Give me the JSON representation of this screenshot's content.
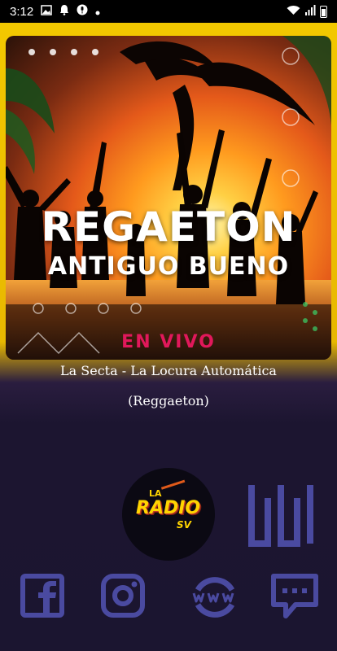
{
  "status_bar": {
    "time": "3:12",
    "signal_text": "all"
  },
  "cover": {
    "title_line1": "REGAETON",
    "title_line2": "ANTIGUO BUENO",
    "live_label": "EN VIVO",
    "live_color": "#e1185b"
  },
  "now_playing": {
    "title": "La Secta - La Locura Automática",
    "genre": "(Reggaeton)"
  },
  "logo": {
    "la": "LA",
    "radio": "RADIO",
    "sv": "SV"
  },
  "social_links": [
    {
      "name": "facebook-icon"
    },
    {
      "name": "instagram-icon"
    },
    {
      "name": "website-icon"
    },
    {
      "name": "chat-icon"
    }
  ],
  "colors": {
    "accent": "#f3c900",
    "background": "#1b1530",
    "icon": "#4a4aa0"
  }
}
